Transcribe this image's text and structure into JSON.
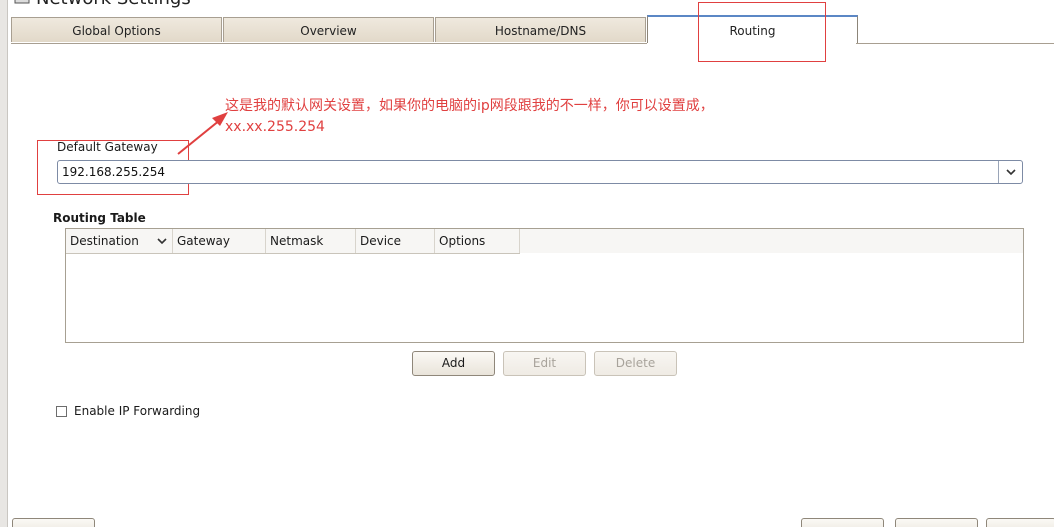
{
  "window": {
    "title": "Network Settings",
    "icon": "network-settings-icon"
  },
  "tabs": [
    {
      "label": "Global Options",
      "active": false
    },
    {
      "label": "Overview",
      "active": false
    },
    {
      "label": "Hostname/DNS",
      "active": false
    },
    {
      "label": "Routing",
      "active": true
    }
  ],
  "annotation": {
    "text": "这是我的默认网关设置，如果你的电脑的ip网段跟我的不一样，你可以设置成，xx.xx.255.254",
    "color": "#e04040"
  },
  "gateway": {
    "label": "Default Gateway",
    "value": "192.168.255.254"
  },
  "routing_table": {
    "title": "Routing Table",
    "columns": [
      "Destination",
      "Gateway",
      "Netmask",
      "Device",
      "Options"
    ],
    "rows": []
  },
  "buttons": {
    "add": "Add",
    "edit": "Edit",
    "delete": "Delete"
  },
  "ip_forwarding": {
    "label": "Enable IP Forwarding",
    "checked": false
  },
  "colors": {
    "accent": "#5b87c5",
    "annotation": "#e04040"
  }
}
